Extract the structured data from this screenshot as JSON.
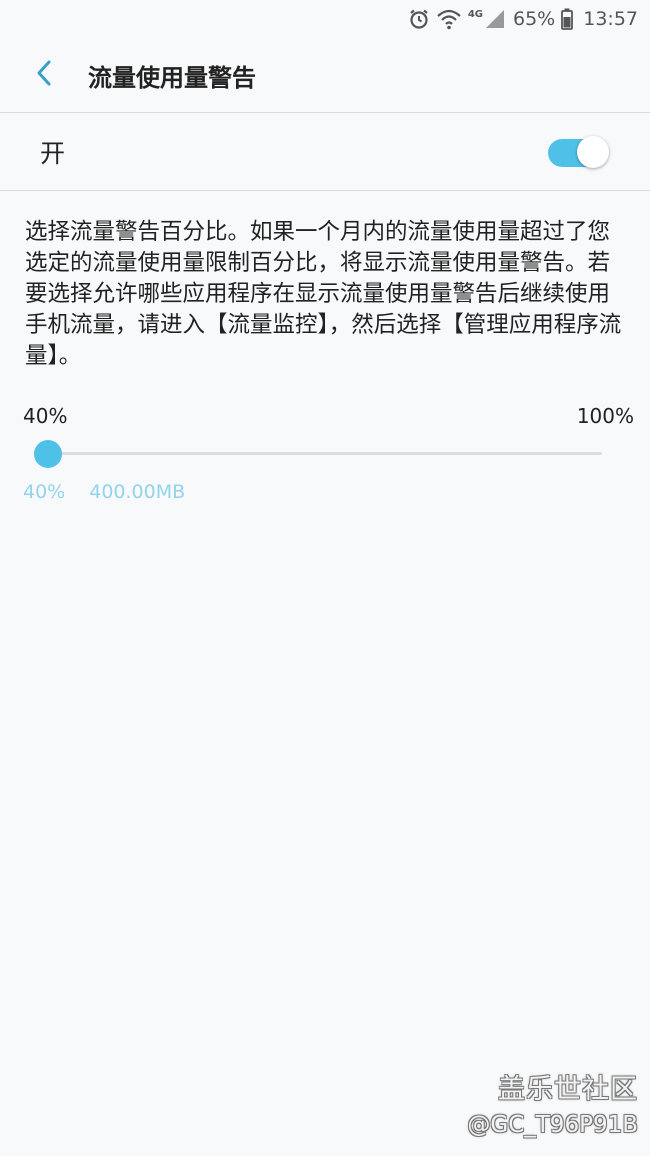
{
  "status_bar": {
    "network": "4G",
    "battery_percent": "65%",
    "time": "13:57",
    "icons": [
      "alarm-icon",
      "wifi-icon",
      "signal-icon",
      "battery-icon"
    ]
  },
  "header": {
    "back_icon": "chevron-left-icon",
    "title": "流量使用量警告"
  },
  "switch": {
    "label": "开",
    "state": "on"
  },
  "description": "选择流量警告百分比。如果一个月内的流量使用量超过了您选定的流量使用量限制百分比，将显示流量使用量警告。若要选择允许哪些应用程序在显示流量使用量警告后继续使用手机流量，请进入【流量监控】，然后选择【管理应用程序流量】。",
  "slider": {
    "min_label": "40%",
    "max_label": "100%",
    "min": 40,
    "max": 100,
    "value": 40,
    "current_percent": "40%",
    "current_amount": "400.00MB"
  },
  "watermark": {
    "line1": "盖乐世社区",
    "line2": "@GC_T96P91B"
  },
  "colors": {
    "accent": "#4fc0e8",
    "readout": "#93d4ec",
    "background": "#f8f9fa",
    "back_arrow": "#3a9fc4"
  }
}
